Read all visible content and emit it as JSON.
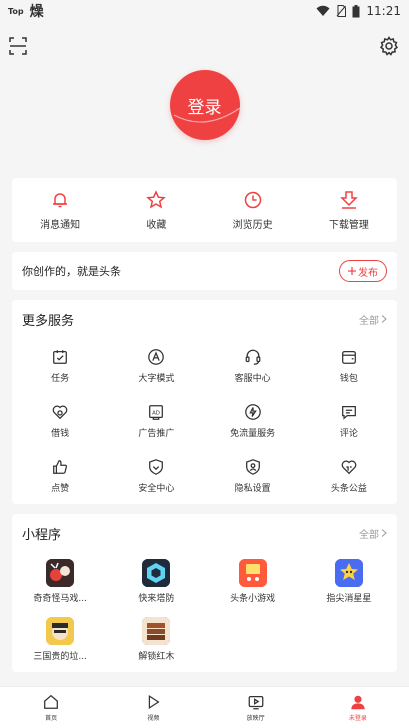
{
  "status": {
    "carrier": "Top",
    "app_glyph": "燥",
    "time": "11:21"
  },
  "login": {
    "label": "登录"
  },
  "quick": [
    {
      "icon": "bell-icon",
      "label": "消息通知"
    },
    {
      "icon": "star-icon",
      "label": "收藏"
    },
    {
      "icon": "clock-icon",
      "label": "浏览历史"
    },
    {
      "icon": "download-icon",
      "label": "下载管理"
    }
  ],
  "create": {
    "text": "你创作的，就是头条",
    "button": "发布"
  },
  "services": {
    "title": "更多服务",
    "all": "全部",
    "items": [
      {
        "icon": "task-icon",
        "label": "任务"
      },
      {
        "icon": "large-font-icon",
        "label": "大字模式"
      },
      {
        "icon": "headset-icon",
        "label": "客服中心"
      },
      {
        "icon": "wallet-icon",
        "label": "钱包"
      },
      {
        "icon": "borrow-icon",
        "label": "借钱"
      },
      {
        "icon": "ad-icon",
        "label": "广告推广"
      },
      {
        "icon": "data-free-icon",
        "label": "免流量服务"
      },
      {
        "icon": "comment-icon",
        "label": "评论"
      },
      {
        "icon": "like-icon",
        "label": "点赞"
      },
      {
        "icon": "shield-icon",
        "label": "安全中心"
      },
      {
        "icon": "privacy-icon",
        "label": "隐私设置"
      },
      {
        "icon": "charity-icon",
        "label": "头条公益"
      }
    ]
  },
  "miniprograms": {
    "title": "小程序",
    "all": "全部",
    "items": [
      {
        "label": "奇奇怪马戏...",
        "color": "#2b2b2b"
      },
      {
        "label": "快来塔防",
        "color": "#1f2a3a"
      },
      {
        "label": "头条小游戏",
        "color": "#ff5a3c"
      },
      {
        "label": "指尖消星星",
        "color": "#4a6cf0"
      },
      {
        "label": "三国贵的垃...",
        "color": "#f2c94c"
      },
      {
        "label": "解锁红木",
        "color": "#8b4a2a"
      }
    ]
  },
  "tabs": [
    {
      "icon": "home-icon",
      "label": "首页",
      "active": false
    },
    {
      "icon": "video-icon",
      "label": "视频",
      "active": false
    },
    {
      "icon": "hall-icon",
      "label": "放映厅",
      "active": false
    },
    {
      "icon": "user-icon",
      "label": "未登录",
      "active": true
    }
  ],
  "colors": {
    "accent": "#f04142"
  }
}
